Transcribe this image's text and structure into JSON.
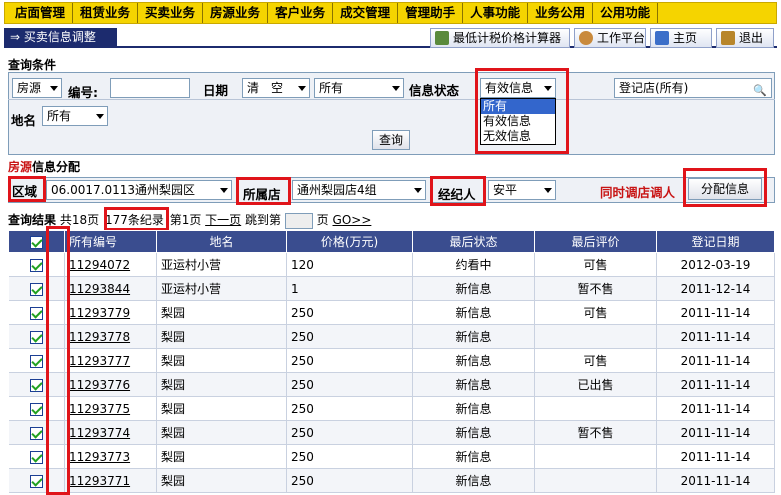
{
  "top_menu": [
    "店面管理",
    "租赁业务",
    "买卖业务",
    "房源业务",
    "客户业务",
    "成交管理",
    "管理助手",
    "人事功能",
    "业务公用",
    "公用功能"
  ],
  "page_title": "⇒ 买卖信息调整",
  "toolbar": {
    "calculator": "最低计税价格计算器",
    "workbench": "工作平台",
    "home": "主页",
    "logout": "退出"
  },
  "query": {
    "section_title": "查询条件",
    "type_value": "房源",
    "number_label": "编号:",
    "date_label": "日期",
    "clear_value": "清　空",
    "date_range_value": "所有",
    "status_label": "信息状态",
    "status_value": "有效信息",
    "status_options": [
      "所有",
      "有效信息",
      "无效信息"
    ],
    "store_value": "登记店(所有)",
    "place_label": "地名",
    "place_value": "所有",
    "query_button": "查询"
  },
  "distribute": {
    "section_title_red": "房源",
    "section_title_rest": "信息分配",
    "area_label": "区域",
    "area_value": "06.0017.0113通州梨园区",
    "store_label": "所属店",
    "store_value": "通州梨园店4组",
    "agent_label": "经纪人",
    "agent_value": "安平",
    "transfer_text": "同时调店调人",
    "assign_button": "分配信息"
  },
  "results": {
    "label": "查询结果",
    "pages": "共18页",
    "records": "177条纪录",
    "current": "第1页",
    "next": "下一页",
    "jump": "跳到第",
    "page_unit": "页",
    "go": "GO>>"
  },
  "table": {
    "headers": [
      "所有编号",
      "地名",
      "价格(万元)",
      "最后状态",
      "最后评价",
      "登记日期"
    ],
    "rows": [
      [
        "11294072",
        "亚运村小营",
        "120",
        "约看中",
        "可售",
        "2012-03-19"
      ],
      [
        "11293844",
        "亚运村小营",
        "1",
        "新信息",
        "暂不售",
        "2011-12-14"
      ],
      [
        "11293779",
        "梨园",
        "250",
        "新信息",
        "可售",
        "2011-11-14"
      ],
      [
        "11293778",
        "梨园",
        "250",
        "新信息",
        "",
        "2011-11-14"
      ],
      [
        "11293777",
        "梨园",
        "250",
        "新信息",
        "可售",
        "2011-11-14"
      ],
      [
        "11293776",
        "梨园",
        "250",
        "新信息",
        "已出售",
        "2011-11-14"
      ],
      [
        "11293775",
        "梨园",
        "250",
        "新信息",
        "",
        "2011-11-14"
      ],
      [
        "11293774",
        "梨园",
        "250",
        "新信息",
        "暂不售",
        "2011-11-14"
      ],
      [
        "11293773",
        "梨园",
        "250",
        "新信息",
        "",
        "2011-11-14"
      ],
      [
        "11293771",
        "梨园",
        "250",
        "新信息",
        "",
        "2011-11-14"
      ]
    ]
  }
}
